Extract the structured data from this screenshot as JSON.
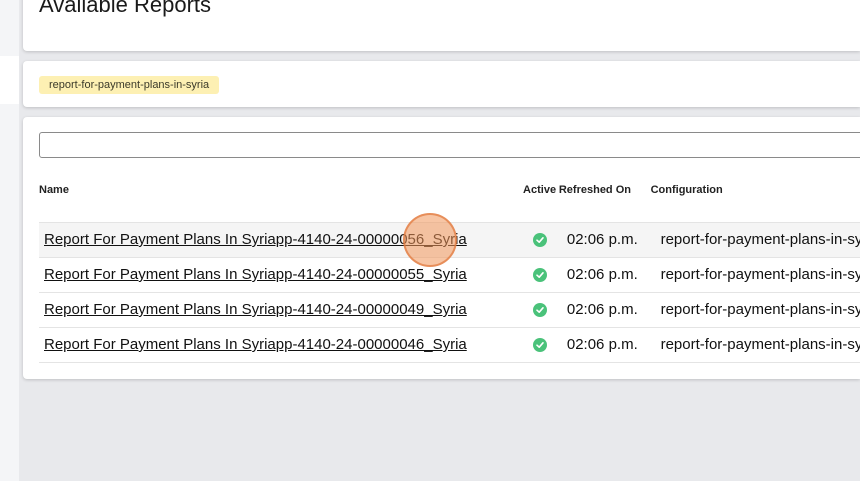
{
  "page": {
    "title": "Available Reports"
  },
  "filters": {
    "tag": "report-for-payment-plans-in-syria"
  },
  "search": {
    "value": "",
    "placeholder": ""
  },
  "table": {
    "headers": {
      "name": "Name",
      "active": "Active",
      "refreshed_on": "Refreshed On",
      "configuration": "Configuration"
    },
    "rows": [
      {
        "name": "Report For Payment Plans In Syriapp-4140-24-00000056_Syria",
        "active": true,
        "refreshed_on": "02:06 p.m.",
        "configuration": "report-for-payment-plans-in-syria"
      },
      {
        "name": "Report For Payment Plans In Syriapp-4140-24-00000055_Syria",
        "active": true,
        "refreshed_on": "02:06 p.m.",
        "configuration": "report-for-payment-plans-in-syria"
      },
      {
        "name": "Report For Payment Plans In Syriapp-4140-24-00000049_Syria",
        "active": true,
        "refreshed_on": "02:06 p.m.",
        "configuration": "report-for-payment-plans-in-syria"
      },
      {
        "name": "Report For Payment Plans In Syriapp-4140-24-00000046_Syria",
        "active": true,
        "refreshed_on": "02:06 p.m.",
        "configuration": "report-for-payment-plans-in-syria"
      }
    ]
  },
  "colors": {
    "active_check": "#4ac27a",
    "tag_background": "#fdf0b3",
    "click_indicator": "#f0965a"
  },
  "icons": {
    "active": "check-circle-icon"
  }
}
